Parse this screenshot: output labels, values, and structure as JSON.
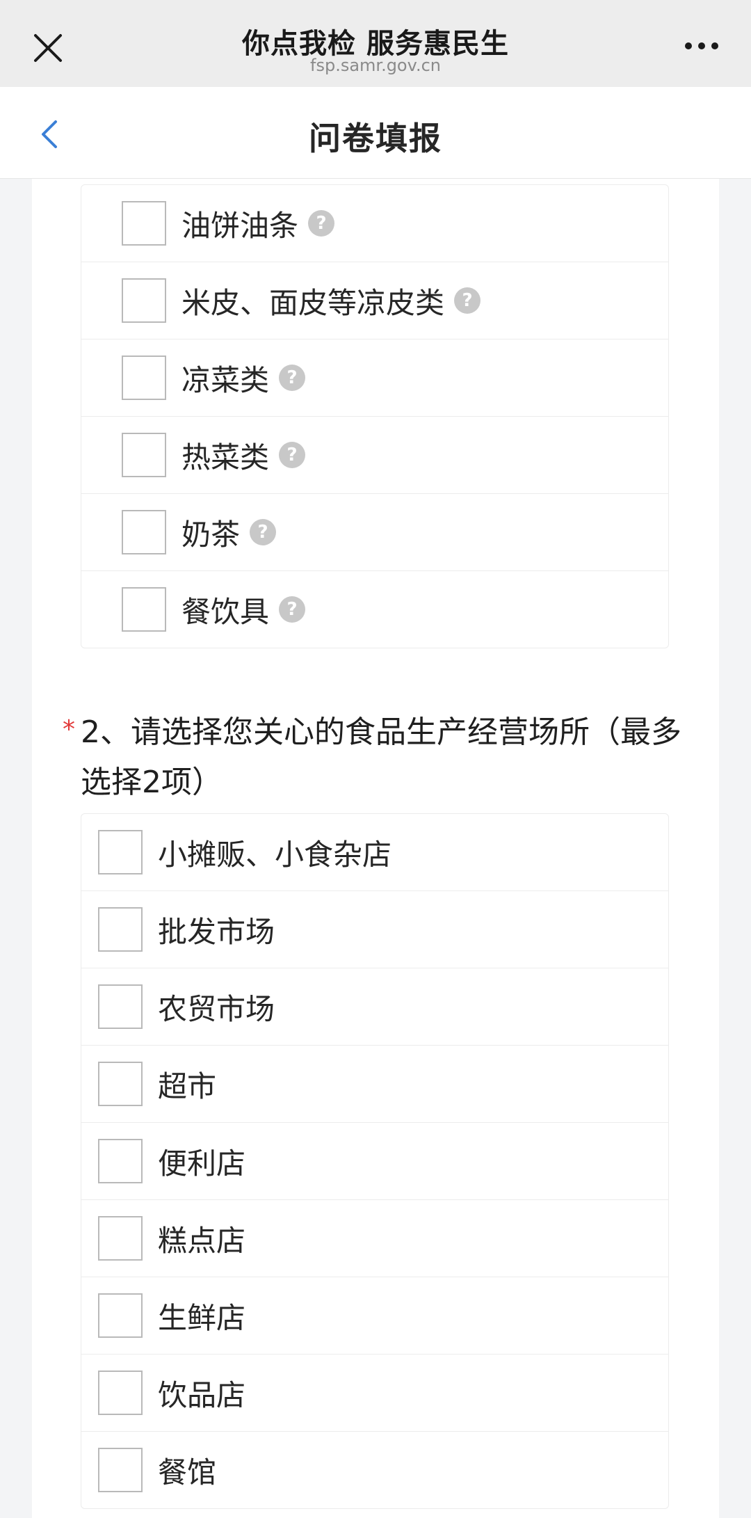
{
  "browser": {
    "title": "你点我检 服务惠民生",
    "url": "fsp.samr.gov.cn",
    "close_icon": "close-icon",
    "more_icon": "more-dots-icon"
  },
  "header": {
    "title": "问卷填报",
    "back_icon": "chevron-left-icon",
    "accent": "#3b7fd6"
  },
  "group1": {
    "options": [
      {
        "label": "油饼油条",
        "help": "?"
      },
      {
        "label": "米皮、面皮等凉皮类",
        "help": "?"
      },
      {
        "label": "凉菜类",
        "help": "?"
      },
      {
        "label": "热菜类",
        "help": "?"
      },
      {
        "label": "奶茶",
        "help": "?"
      },
      {
        "label": "餐饮具",
        "help": "?"
      }
    ]
  },
  "question2": {
    "required_mark": "*",
    "text": "2、请选择您关心的食品生产经营场所（最多选择2项）",
    "required_color": "#e23a3a",
    "options": [
      {
        "label": "小摊贩、小食杂店"
      },
      {
        "label": "批发市场"
      },
      {
        "label": "农贸市场"
      },
      {
        "label": "超市"
      },
      {
        "label": "便利店"
      },
      {
        "label": "糕点店"
      },
      {
        "label": "生鲜店"
      },
      {
        "label": "饮品店"
      },
      {
        "label": "餐馆"
      }
    ]
  }
}
